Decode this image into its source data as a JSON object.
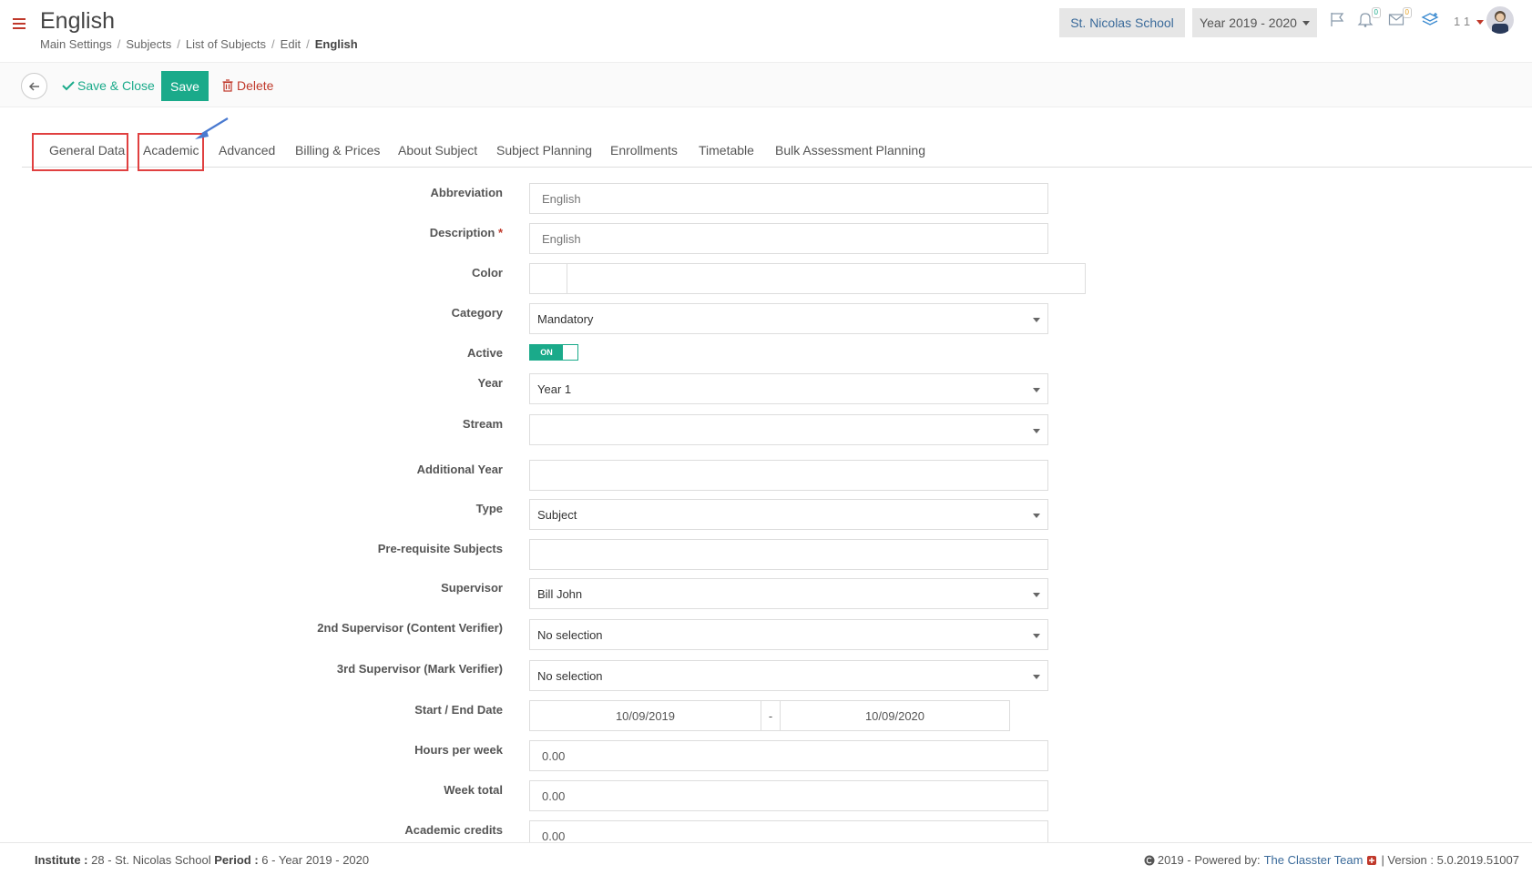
{
  "header": {
    "title": "English",
    "breadcrumb": [
      "Main Settings",
      "Subjects",
      "List of Subjects",
      "Edit"
    ],
    "breadcrumb_current": "English",
    "school": "St. Nicolas School",
    "year": "Year 2019 - 2020",
    "notifications_count": "0",
    "messages_count": "0",
    "user_count": "1 1",
    "icons": [
      "menu-icon",
      "flag-icon",
      "bell-icon",
      "envelope-icon",
      "layers-icon",
      "avatar"
    ]
  },
  "toolbar": {
    "save_close_label": "Save & Close",
    "save_label": "Save",
    "delete_label": "Delete"
  },
  "tabs": [
    {
      "label": "General Data"
    },
    {
      "label": "Academic"
    },
    {
      "label": "Advanced"
    },
    {
      "label": "Billing & Prices"
    },
    {
      "label": "About Subject"
    },
    {
      "label": "Subject Planning"
    },
    {
      "label": "Enrollments"
    },
    {
      "label": "Timetable"
    },
    {
      "label": "Bulk Assessment Planning"
    }
  ],
  "form": {
    "abbreviation": {
      "label": "Abbreviation",
      "placeholder": "English"
    },
    "description": {
      "label": "Description",
      "placeholder": "English",
      "required_mark": "*"
    },
    "color": {
      "label": "Color"
    },
    "category": {
      "label": "Category",
      "value": "Mandatory"
    },
    "active": {
      "label": "Active",
      "toggle_text": "ON"
    },
    "year": {
      "label": "Year",
      "value": "Year 1"
    },
    "stream": {
      "label": "Stream",
      "value": ""
    },
    "additional_year": {
      "label": "Additional Year",
      "value": ""
    },
    "type": {
      "label": "Type",
      "value": "Subject"
    },
    "prerequisite": {
      "label": "Pre-requisite Subjects",
      "value": ""
    },
    "supervisor": {
      "label": "Supervisor",
      "value": "Bill John"
    },
    "supervisor2": {
      "label": "2nd Supervisor (Content Verifier)",
      "value": "No selection"
    },
    "supervisor3": {
      "label": "3rd Supervisor (Mark Verifier)",
      "value": "No selection"
    },
    "dates": {
      "label": "Start / End Date",
      "start": "10/09/2019",
      "separator": "-",
      "end": "10/09/2020"
    },
    "hours_per_week": {
      "label": "Hours per week",
      "value": "0.00"
    },
    "week_total": {
      "label": "Week total",
      "value": "0.00"
    },
    "academic_credits": {
      "label": "Academic credits",
      "value": "0.00"
    }
  },
  "footer": {
    "institute_label": "Institute :",
    "institute_value": "28 - St. Nicolas School",
    "period_label": "Period :",
    "period_value": "6 - Year 2019 - 2020",
    "powered_prefix": "2019 - Powered by:",
    "powered_link": "The Classter Team",
    "version": "| Version : 5.0.2019.51007"
  },
  "colors": {
    "accent": "#1aaa8a",
    "danger": "#c0392b",
    "link": "#3a6a9a",
    "highlight": "#e04040"
  }
}
